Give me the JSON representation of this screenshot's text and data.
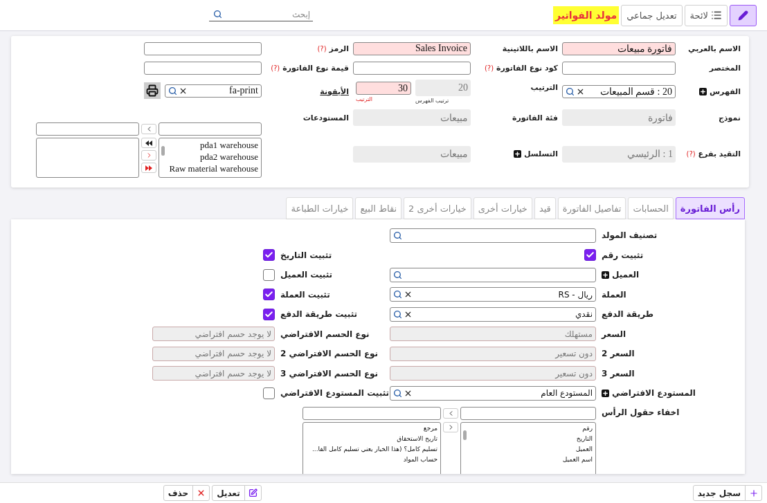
{
  "header": {
    "buttons": [
      {
        "kind": "edit",
        "selected": true
      },
      {
        "kind": "list",
        "label": "لائحة",
        "selected": false
      },
      {
        "kind": "text",
        "label": "تعديل جماعي",
        "selected": false
      }
    ],
    "title": "مولد الفواتير",
    "search": {
      "placeholder": "إبحث"
    }
  },
  "details": {
    "rows": [
      [
        {
          "label": "الاسم بالعربي",
          "kind": "text",
          "value": "فاتورة مبيعات",
          "required": true
        },
        {
          "label": "الاسم باللاتينية",
          "kind": "text",
          "value": "Sales Invoice",
          "required": true
        },
        {
          "label": "الرمز",
          "hint": "(?)",
          "kind": "text"
        }
      ],
      [
        {
          "label": "المختصر",
          "kind": "text"
        },
        {
          "label": "كود نوع الفاتورة",
          "hint": "(?)",
          "kind": "text"
        },
        {
          "label": "قيمة نوع الفاتورة",
          "hint": "(?)",
          "kind": "text"
        }
      ],
      [
        {
          "label": "الفهرس",
          "add": true,
          "kind": "lookup",
          "value": "20 : قسم المبيعات"
        },
        {
          "label": "الترتيب",
          "kind": "order_pair",
          "parts": [
            {
              "value": "20",
              "caption": "ترتيب الفهرس",
              "disabled": true,
              "required": false
            },
            {
              "value": "30",
              "caption": "الترتيب",
              "disabled": false,
              "required": true
            }
          ]
        },
        {
          "label": "الأيقونة",
          "link": true,
          "kind": "icon_lookup",
          "value": "fa-print"
        }
      ],
      [
        {
          "label": "نموذج",
          "kind": "text",
          "value": "فاتورة",
          "disabled": true
        },
        {
          "label": "فئة الفاتورة",
          "kind": "text",
          "value": "مبيعات",
          "disabled": true
        }
      ],
      [
        {
          "label": "التقيد بفرع",
          "hint": "(?)",
          "kind": "text",
          "value": "1 : الرئيسي",
          "disabled": true
        },
        {
          "label": "التسلسل",
          "add": true,
          "kind": "text",
          "value": "مبيعات",
          "disabled": true
        }
      ]
    ],
    "warehouses": {
      "label": "المستودعات",
      "options": [
        "pda1 warehouse",
        "pda2 warehouse",
        "Raw material warehouse"
      ]
    }
  },
  "tabs": [
    {
      "label": "رأس الفاتورة",
      "selected": true
    },
    {
      "label": "الحسابات",
      "selected": false
    },
    {
      "label": "تفاصيل الفاتورة",
      "selected": false
    },
    {
      "label": "قيد",
      "selected": false
    },
    {
      "label": "خيارات أخرى",
      "selected": false
    },
    {
      "label": "خيارات أخرى 2",
      "selected": false
    },
    {
      "label": "نقاط البيع",
      "selected": false
    },
    {
      "label": "خيارات الطباعة",
      "selected": false
    }
  ],
  "form": {
    "rows": [
      [
        {
          "label": "تصنيف المولد",
          "kind": "lookup"
        }
      ],
      [
        {
          "label": "تثبيت رقم",
          "kind": "checkbox",
          "checked": true
        },
        {
          "label": "تثبيت التاريخ",
          "kind": "checkbox",
          "checked": true
        }
      ],
      [
        {
          "label": "العميل",
          "add": true,
          "kind": "lookup"
        },
        {
          "label": "تثبيت العميل",
          "kind": "checkbox",
          "checked": false
        }
      ],
      [
        {
          "label": "العملة",
          "kind": "lookup",
          "value": "ريال - RS"
        },
        {
          "label": "تثبيت العملة",
          "kind": "checkbox",
          "checked": true
        }
      ],
      [
        {
          "label": "طريقة الدفع",
          "kind": "lookup",
          "value": "نقدي"
        },
        {
          "label": "تثبيت طريقة الدفع",
          "kind": "checkbox",
          "checked": true
        }
      ],
      [
        {
          "label": "السعر",
          "kind": "text",
          "value": "مستهلك",
          "disabled": true
        },
        {
          "label": "نوع الحسم الافتراضي",
          "kind": "text",
          "value": "لا يوجد حسم افتراضي",
          "disabled": true
        }
      ],
      [
        {
          "label": "السعر 2",
          "kind": "text",
          "value": "دون تسعير",
          "disabled": true
        },
        {
          "label": "نوع الحسم الافتراضي 2",
          "kind": "text",
          "value": "لا يوجد حسم افتراضي",
          "disabled": true
        }
      ],
      [
        {
          "label": "السعر 3",
          "kind": "text",
          "value": "دون تسعير",
          "disabled": true
        },
        {
          "label": "نوع الحسم الافتراضي 3",
          "kind": "text",
          "value": "لا يوجد حسم افتراضي",
          "disabled": true
        }
      ],
      [
        {
          "label": "المستودع الافتراضي",
          "add": true,
          "kind": "lookup",
          "value": "المستودع العام"
        },
        {
          "label": "تثبيت المستودع الافتراضي",
          "kind": "checkbox",
          "checked": false
        }
      ]
    ],
    "hide_header_fields": {
      "label": "اخفاء حقول الرأس",
      "options": [
        "رقم",
        "التاريخ",
        "العميل",
        "اسم العميل"
      ],
      "chosen": [
        "مرجع",
        "تاريخ الاستحقاق",
        "تسليم كامل؟ (هذا الخيار يعني تسليم كامل الفا...",
        "حساب المواد"
      ]
    }
  },
  "actions": [
    {
      "kind": "new",
      "label": "سجل جديد"
    },
    {
      "kind": "edit",
      "label": "تعديل"
    },
    {
      "kind": "delete",
      "label": "حذف"
    }
  ]
}
